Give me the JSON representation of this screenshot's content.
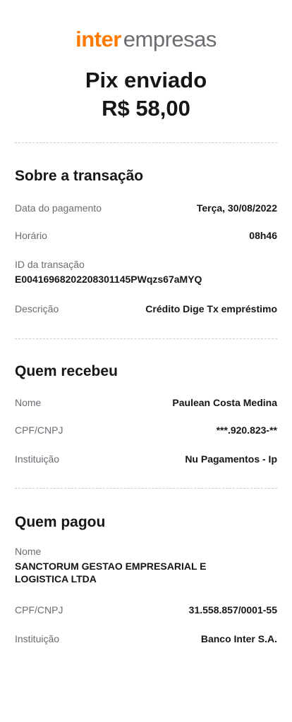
{
  "brand": {
    "part1": "inter",
    "part2": "empresas"
  },
  "header": {
    "title": "Pix enviado",
    "amount": "R$ 58,00"
  },
  "transacao": {
    "heading": "Sobre a transação",
    "data_label": "Data do pagamento",
    "data_value": "Terça, 30/08/2022",
    "horario_label": "Horário",
    "horario_value": "08h46",
    "id_label": "ID da transação",
    "id_value": "E00416968202208301145PWqzs67aMYQ",
    "descricao_label": "Descrição",
    "descricao_value": "Crédito Dige Tx empréstimo"
  },
  "recebeu": {
    "heading": "Quem recebeu",
    "nome_label": "Nome",
    "nome_value": "Paulean Costa Medina",
    "cpf_label": "CPF/CNPJ",
    "cpf_value": "***.920.823-**",
    "inst_label": "Instituição",
    "inst_value": "Nu Pagamentos - Ip"
  },
  "pagou": {
    "heading": "Quem pagou",
    "nome_label": "Nome",
    "nome_value": "SANCTORUM GESTAO EMPRESARIAL E LOGISTICA LTDA",
    "cpf_label": "CPF/CNPJ",
    "cpf_value": "31.558.857/0001-55",
    "inst_label": "Instituição",
    "inst_value": "Banco Inter S.A."
  }
}
